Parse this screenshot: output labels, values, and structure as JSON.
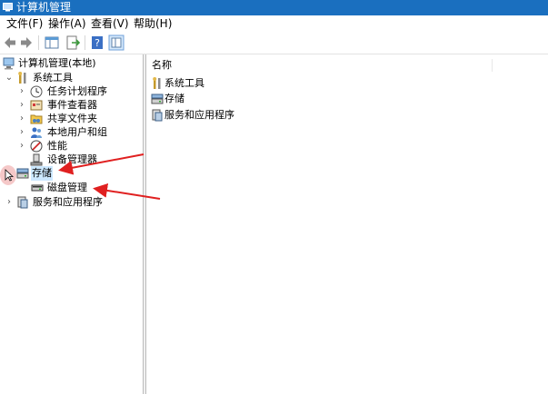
{
  "window": {
    "title": "计算机管理"
  },
  "menu": [
    {
      "label": "文件(F)"
    },
    {
      "label": "操作(A)"
    },
    {
      "label": "查看(V)"
    },
    {
      "label": "帮助(H)"
    }
  ],
  "toolbar": {
    "buttons": [
      "back-icon",
      "forward-icon",
      "show-hide-tree-icon",
      "export-list-icon",
      "help-icon",
      "console-view-icon"
    ]
  },
  "tree": {
    "root": {
      "label": "计算机管理(本地)"
    },
    "system_tools": {
      "label": "系统工具",
      "expanded": true
    },
    "task_scheduler": {
      "label": "任务计划程序"
    },
    "event_viewer": {
      "label": "事件查看器"
    },
    "shared_folders": {
      "label": "共享文件夹"
    },
    "local_users": {
      "label": "本地用户和组"
    },
    "performance": {
      "label": "性能"
    },
    "device_manager": {
      "label": "设备管理器"
    },
    "storage": {
      "label": "存储",
      "selected": true,
      "expanded": true
    },
    "disk_management": {
      "label": "磁盘管理"
    },
    "services_apps": {
      "label": "服务和应用程序"
    }
  },
  "list": {
    "header": "名称",
    "items": [
      {
        "label": "系统工具",
        "icon": "tools-icon"
      },
      {
        "label": "存储",
        "icon": "storage-icon"
      },
      {
        "label": "服务和应用程序",
        "icon": "services-icon"
      }
    ]
  },
  "colors": {
    "titlebar": "#1a6fbf",
    "selection": "#cce8ff",
    "annotation_arrow": "#e02020"
  }
}
